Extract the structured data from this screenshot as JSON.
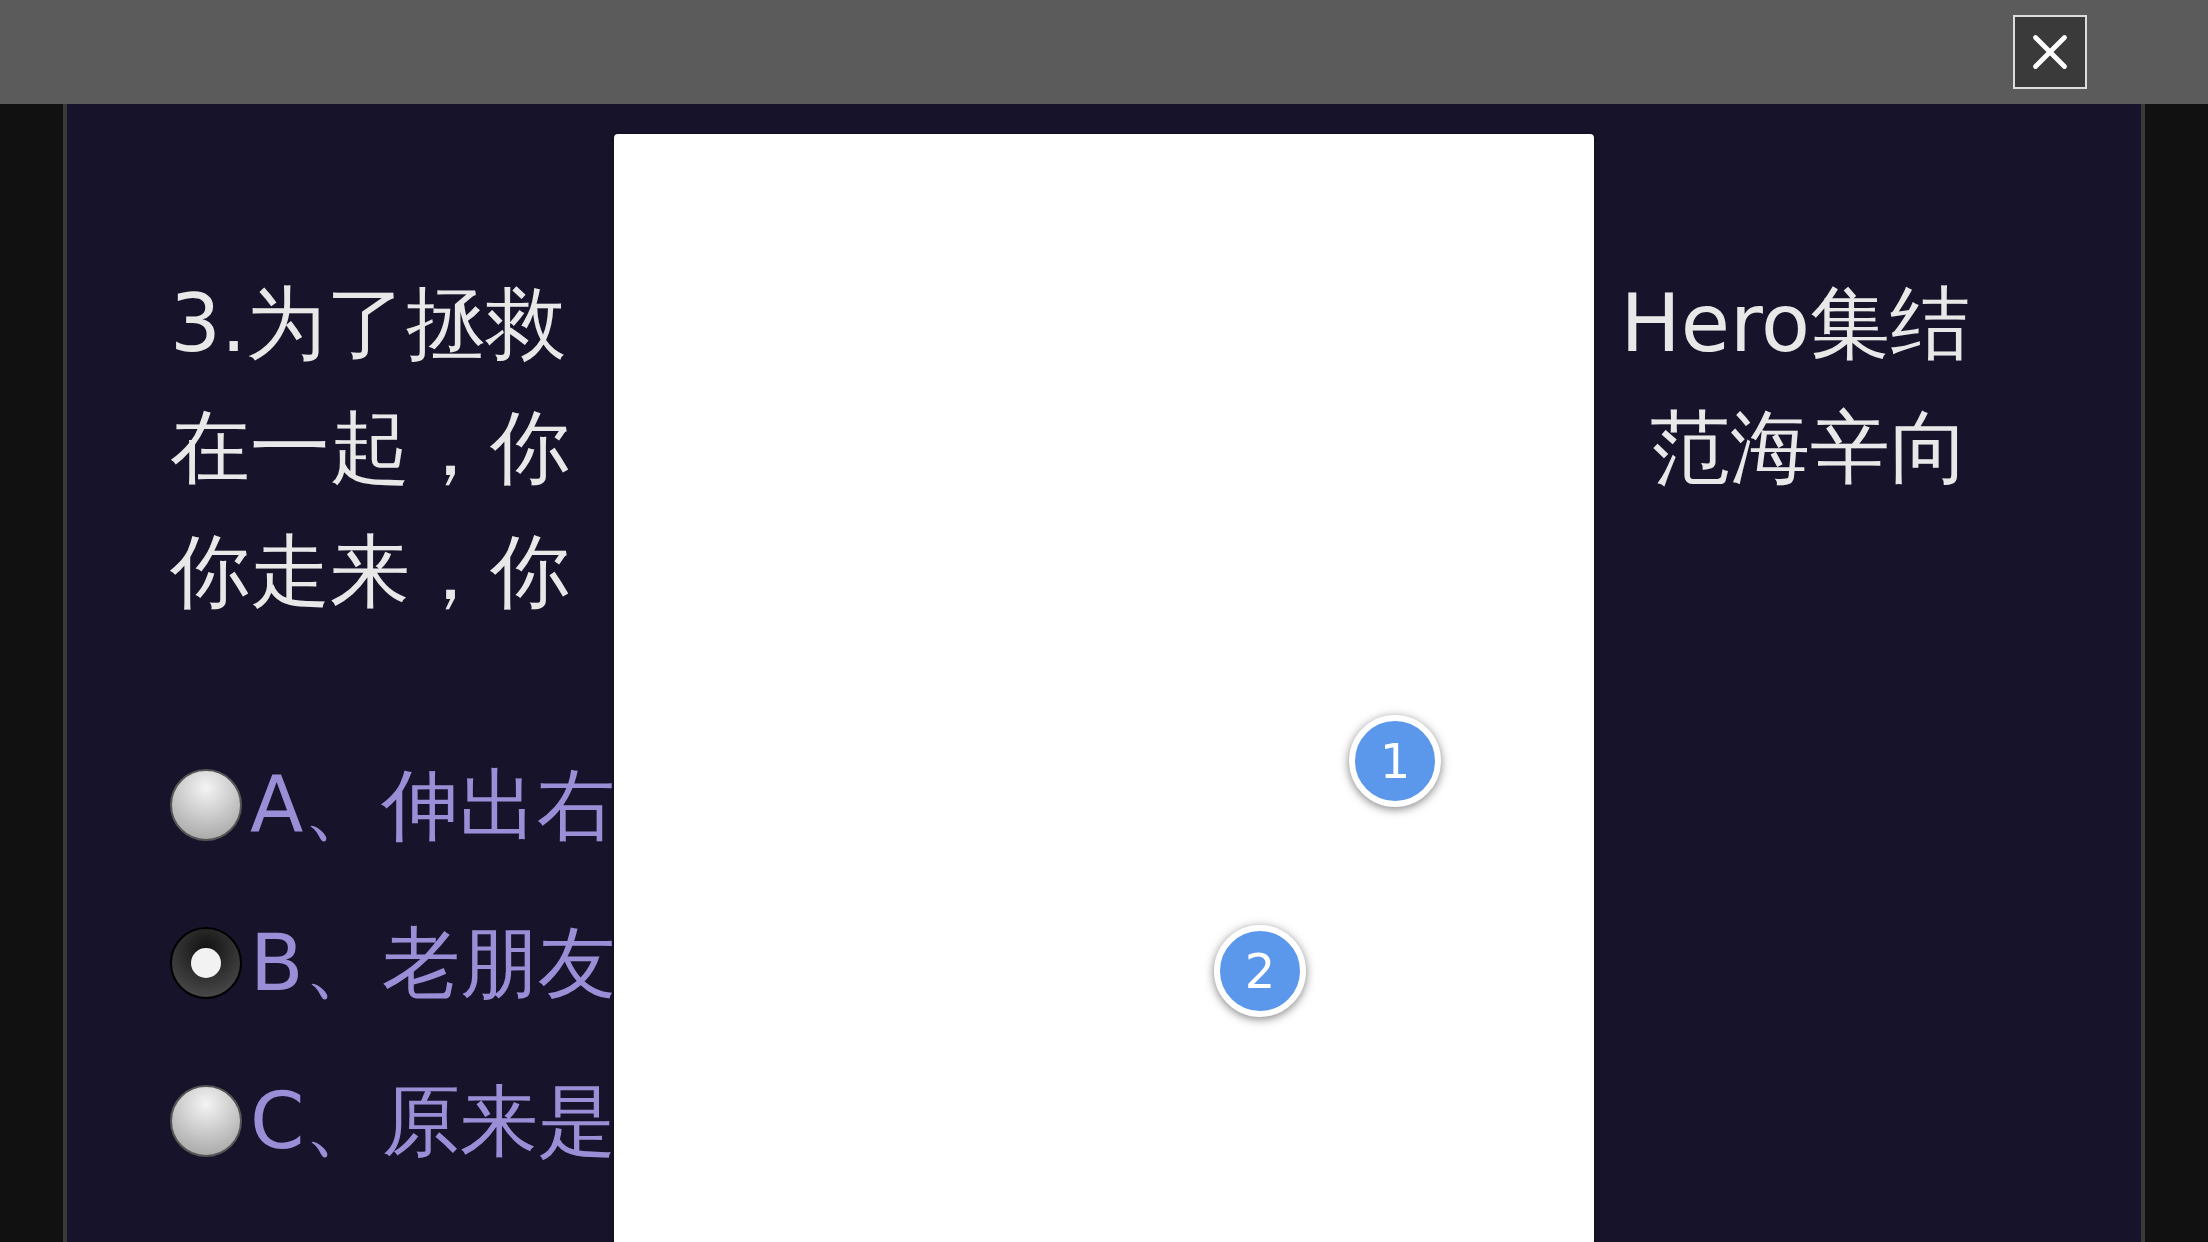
{
  "question": {
    "lines": [
      {
        "left": "3.为了拯救",
        "right": "Hero集结"
      },
      {
        "left": "在一起，你",
        "right": "范海辛向"
      },
      {
        "left": "你走来，你"
      }
    ]
  },
  "options": [
    {
      "label": "A、伸出右",
      "selected": false
    },
    {
      "label": "B、老朋友",
      "selected": true
    },
    {
      "label": "C、原来是",
      "selected": false
    }
  ],
  "markers": [
    "1",
    "2"
  ]
}
